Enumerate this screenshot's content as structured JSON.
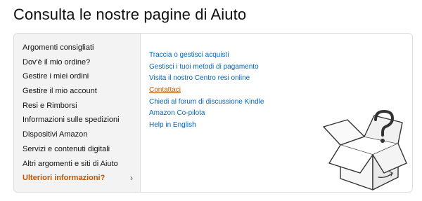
{
  "page": {
    "title": "Consulta le nostre pagine di Aiuto"
  },
  "sidebar": {
    "items": [
      {
        "label": "Argomenti consigliati"
      },
      {
        "label": "Dov'è il mio ordine?"
      },
      {
        "label": "Gestire i miei ordini"
      },
      {
        "label": "Gestire il mio account"
      },
      {
        "label": "Resi e Rimborsi"
      },
      {
        "label": "Informazioni sulle spedizioni"
      },
      {
        "label": "Dispositivi Amazon"
      },
      {
        "label": "Servizi e contenuti digitali"
      },
      {
        "label": "Altri argomenti e siti di Aiuto"
      },
      {
        "label": "Ulteriori informazioni?",
        "active": true,
        "chevron": "›"
      }
    ]
  },
  "links": [
    {
      "label": "Traccia o gestisci acquisti"
    },
    {
      "label": "Gestisci i tuoi metodi di pagamento"
    },
    {
      "label": "Visita il nostro Centro resi online"
    },
    {
      "label": "Contattaci",
      "state": "hover"
    },
    {
      "label": "Chiedi al forum di discussione Kindle"
    },
    {
      "label": "Amazon Co-pilota"
    },
    {
      "label": "Help in English"
    }
  ],
  "illustration": {
    "icon": "question-box-icon"
  },
  "colors": {
    "link": "#0066c0",
    "accent": "#c45500",
    "sidebar_bg": "#f3f3f3"
  }
}
